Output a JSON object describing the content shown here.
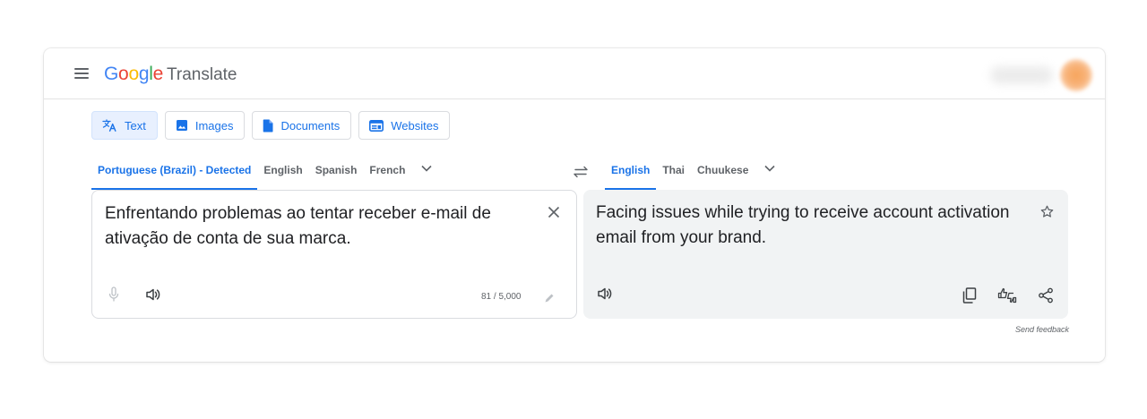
{
  "app": {
    "logo_letters": [
      "G",
      "o",
      "o",
      "g",
      "l",
      "e"
    ],
    "product_name": "Translate"
  },
  "modes": [
    {
      "label": "Text",
      "icon": "translate-icon",
      "active": true
    },
    {
      "label": "Images",
      "icon": "image-icon",
      "active": false
    },
    {
      "label": "Documents",
      "icon": "document-icon",
      "active": false
    },
    {
      "label": "Websites",
      "icon": "website-icon",
      "active": false
    }
  ],
  "source_languages": {
    "detected": "Portuguese (Brazil) - Detected",
    "options": [
      "English",
      "Spanish",
      "French"
    ]
  },
  "target_languages": {
    "selected": "English",
    "options": [
      "Thai",
      "Chuukese"
    ]
  },
  "source": {
    "text": "Enfrentando problemas ao tentar receber e-mail de ativação de conta de sua marca.",
    "char_count": "81 / 5,000"
  },
  "target": {
    "text": "Facing issues while trying to receive account activation email from your brand."
  },
  "feedback_label": "Send feedback",
  "colors": {
    "accent": "#1a73e8",
    "active_tab_bg": "#e8f0fe",
    "output_panel_bg": "#f1f3f4",
    "icon_gray": "#5f6368"
  }
}
